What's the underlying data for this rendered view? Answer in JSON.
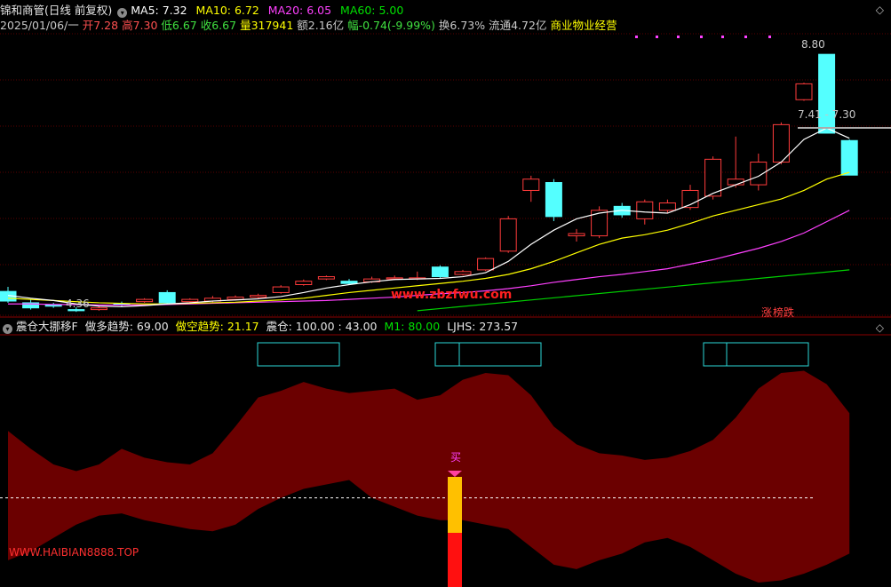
{
  "header": {
    "title": "锦和商管(日线 前复权)",
    "ma5_label": "MA5: 7.32",
    "ma10_label": "MA10: 6.72",
    "ma20_label": "MA20: 6.05",
    "ma60_label": "MA60: 5.00",
    "date": "2025/01/06/一",
    "open": "开7.28",
    "high": "高7.30",
    "low": "低6.67",
    "close": "收6.67",
    "volume": "量317941",
    "amount": "额2.16亿",
    "change": "幅-0.74(-9.99%)",
    "turnover": "换6.73%",
    "float_cap": "流通4.72亿",
    "sector": "商业物业经营"
  },
  "price_chart": {
    "high_label": "8.80",
    "last_label": "7.41 - 7.30",
    "low_label": "4.36",
    "watermark": "www.zbzfwu.com",
    "limit_tag": "涨",
    "limit_tag2": "榜跌"
  },
  "indicator": {
    "name": "震仓大挪移F",
    "bull_label": "做多趋势: 69.00",
    "bear_label": "做空趋势: 21.17",
    "shake_label": "震仓: 100.00 : 43.00",
    "m1_label": "M1: 80.00",
    "ljhs_label": "LJHS: 273.57",
    "buy_signal": "买",
    "watermark": "WWW.HAIBIAN8888.TOP"
  },
  "colors": {
    "up": "#ff3b3b",
    "down": "#54ffff",
    "ma5": "#ffffff",
    "ma10": "#ffff00",
    "ma20": "#ff40ff",
    "ma60": "#00d000",
    "band": "#6b0000",
    "grid": "#7a0000"
  },
  "chart_data": {
    "type": "candlestick",
    "ylim": [
      4.2,
      9.1
    ],
    "candles": [
      [
        4.62,
        4.45,
        4.7,
        4.42
      ],
      [
        4.42,
        4.33,
        4.48,
        4.3
      ],
      [
        4.38,
        4.36,
        4.42,
        4.33
      ],
      [
        4.3,
        4.28,
        4.34,
        4.26
      ],
      [
        4.3,
        4.33,
        4.36,
        4.28
      ],
      [
        4.4,
        4.38,
        4.44,
        4.35
      ],
      [
        4.44,
        4.48,
        4.5,
        4.42
      ],
      [
        4.6,
        4.42,
        4.64,
        4.4
      ],
      [
        4.44,
        4.48,
        4.5,
        4.42
      ],
      [
        4.45,
        4.5,
        4.54,
        4.43
      ],
      [
        4.48,
        4.52,
        4.55,
        4.46
      ],
      [
        4.52,
        4.55,
        4.58,
        4.5
      ],
      [
        4.6,
        4.7,
        4.73,
        4.58
      ],
      [
        4.74,
        4.8,
        4.83,
        4.72
      ],
      [
        4.84,
        4.88,
        4.9,
        4.82
      ],
      [
        4.8,
        4.76,
        4.84,
        4.74
      ],
      [
        4.79,
        4.84,
        4.88,
        4.77
      ],
      [
        4.84,
        4.86,
        4.9,
        4.82
      ],
      [
        4.84,
        4.86,
        4.97,
        4.82
      ],
      [
        5.05,
        4.88,
        5.08,
        4.85
      ],
      [
        4.92,
        4.97,
        5.0,
        4.9
      ],
      [
        5.0,
        5.2,
        5.22,
        4.98
      ],
      [
        5.33,
        5.9,
        5.95,
        5.3
      ],
      [
        6.4,
        6.6,
        6.66,
        6.2
      ],
      [
        6.54,
        5.94,
        6.6,
        5.86
      ],
      [
        5.6,
        5.64,
        5.72,
        5.5
      ],
      [
        5.6,
        6.05,
        6.12,
        5.56
      ],
      [
        6.12,
        5.97,
        6.18,
        5.92
      ],
      [
        5.9,
        6.2,
        6.24,
        5.8
      ],
      [
        6.05,
        6.18,
        6.24,
        6.0
      ],
      [
        6.1,
        6.4,
        6.5,
        6.06
      ],
      [
        6.3,
        6.95,
        7.0,
        6.24
      ],
      [
        6.5,
        6.6,
        7.35,
        6.45
      ],
      [
        6.5,
        6.9,
        7.05,
        6.4
      ],
      [
        6.9,
        7.56,
        7.6,
        6.86
      ],
      [
        8.0,
        8.28,
        8.3,
        7.98
      ],
      [
        8.8,
        7.41,
        8.8,
        7.41
      ],
      [
        7.28,
        6.67,
        7.3,
        6.67
      ]
    ],
    "ma5": [
      4.55,
      4.5,
      4.46,
      4.4,
      4.36,
      4.35,
      4.37,
      4.4,
      4.42,
      4.45,
      4.47,
      4.49,
      4.53,
      4.6,
      4.68,
      4.74,
      4.79,
      4.83,
      4.84,
      4.85,
      4.88,
      4.95,
      5.15,
      5.45,
      5.7,
      5.9,
      6.0,
      6.05,
      6.02,
      6.0,
      6.15,
      6.35,
      6.5,
      6.65,
      6.9,
      7.3,
      7.5,
      7.32
    ],
    "ma10": [
      4.5,
      4.48,
      4.46,
      4.44,
      4.42,
      4.41,
      4.4,
      4.4,
      4.41,
      4.42,
      4.43,
      4.45,
      4.47,
      4.5,
      4.55,
      4.6,
      4.64,
      4.68,
      4.72,
      4.76,
      4.8,
      4.85,
      4.92,
      5.02,
      5.15,
      5.3,
      5.45,
      5.56,
      5.62,
      5.7,
      5.82,
      5.95,
      6.05,
      6.15,
      6.25,
      6.4,
      6.6,
      6.72
    ],
    "ma20": [
      4.4,
      4.4,
      4.39,
      4.39,
      4.38,
      4.38,
      4.38,
      4.39,
      4.4,
      4.41,
      4.42,
      4.43,
      4.44,
      4.45,
      4.46,
      4.48,
      4.5,
      4.52,
      4.55,
      4.58,
      4.6,
      4.63,
      4.67,
      4.72,
      4.78,
      4.83,
      4.88,
      4.92,
      4.97,
      5.02,
      5.1,
      5.18,
      5.28,
      5.38,
      5.5,
      5.65,
      5.85,
      6.05
    ],
    "ma60_x": [
      18,
      37
    ],
    "ma60": [
      4.28,
      5.0
    ],
    "indicator_ylim": [
      0,
      100
    ],
    "indicator_top": [
      70,
      62,
      55,
      52,
      55,
      62,
      58,
      56,
      55,
      60,
      72,
      85,
      88,
      92,
      89,
      87,
      88,
      89,
      84,
      86,
      93,
      96,
      95,
      86,
      72,
      64,
      60,
      59,
      57,
      58,
      61,
      66,
      76,
      89,
      96,
      97,
      91,
      78
    ],
    "indicator_bottom": [
      12,
      16,
      22,
      28,
      32,
      33,
      30,
      28,
      26,
      25,
      28,
      35,
      40,
      44,
      46,
      48,
      40,
      36,
      32,
      30,
      30,
      28,
      26,
      18,
      10,
      8,
      12,
      15,
      20,
      22,
      18,
      12,
      6,
      2,
      3,
      6,
      10,
      15
    ],
    "indicator_mid": 40
  }
}
